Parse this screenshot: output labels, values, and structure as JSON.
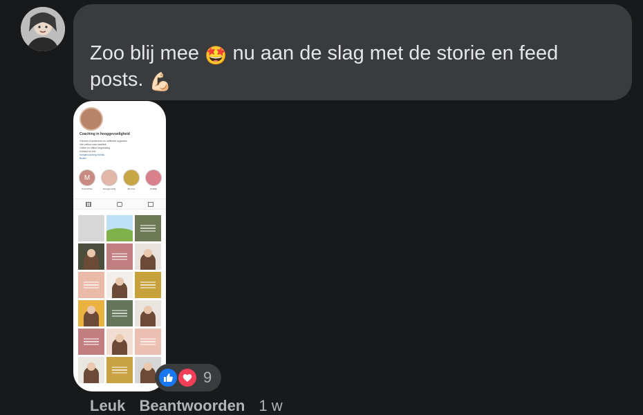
{
  "comment": {
    "author_name_partial": "",
    "text_before_emoji": "Zoo blij mee",
    "emoji_1": "🤩",
    "text_after_emoji": "nu aan de slag met de storie en feed posts.",
    "emoji_2": "💪🏻"
  },
  "attachment": {
    "profile_name": "Coaching in hooggevoeligheid",
    "bio_lines": [
      "Grenzen (h)erkennen en zelfbeeld opgraden",
      "Van zelfsut naar kwaliteit",
      "Online en offline begeleiding",
      "Contact en info"
    ],
    "bio_links": [
      "hsmgecoaching.nl/links",
      "Bruten"
    ],
    "highlights": [
      {
        "label": "Overzichten",
        "color": "#c98a82",
        "icon": "M"
      },
      {
        "label": "Hooggevoelig",
        "color": "#e2b7a8",
        "icon": ""
      },
      {
        "label": "Me time",
        "color": "#c9a645",
        "icon": ""
      },
      {
        "label": "Praktijk",
        "color": "#d9808a",
        "icon": ""
      }
    ],
    "grid_tiles": [
      {
        "type": "plain",
        "color": "#d7d7d7"
      },
      {
        "type": "landscape",
        "color": "#bfe0f5"
      },
      {
        "type": "text",
        "color": "#6e7a55"
      },
      {
        "type": "person",
        "color": "#4b4e3d"
      },
      {
        "type": "text",
        "color": "#c27f82"
      },
      {
        "type": "person",
        "color": "#e8e2dc"
      },
      {
        "type": "text",
        "color": "#eab9a7"
      },
      {
        "type": "person",
        "color": "#f2eeea"
      },
      {
        "type": "text",
        "color": "#c7a23c"
      },
      {
        "type": "person",
        "color": "#e9b13f"
      },
      {
        "type": "text",
        "color": "#657559"
      },
      {
        "type": "person",
        "color": "#e9e4de"
      },
      {
        "type": "text",
        "color": "#c27d7e"
      },
      {
        "type": "person",
        "color": "#f1ddd1"
      },
      {
        "type": "text",
        "color": "#ecc1b3"
      },
      {
        "type": "person",
        "color": "#eae6e0"
      },
      {
        "type": "text",
        "color": "#c9a343"
      },
      {
        "type": "person",
        "color": "#d6d6d6"
      }
    ]
  },
  "reactions": {
    "count": "9",
    "like_icon": "thumbs-up-icon",
    "love_icon": "heart-icon",
    "like_color": "#1877f2",
    "love_color": "#f33e58"
  },
  "footer": {
    "like_label": "Leuk",
    "reply_label": "Beantwoorden",
    "time": "1 w"
  }
}
